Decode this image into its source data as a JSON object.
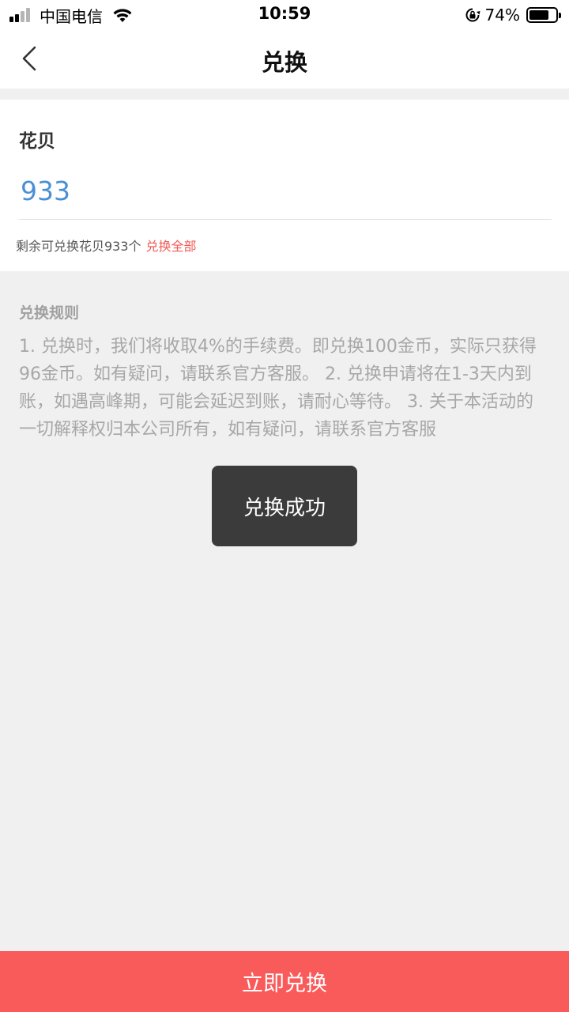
{
  "status_bar": {
    "carrier": "中国电信",
    "time": "10:59",
    "battery_percent": "74%",
    "battery_level": 0.74,
    "signal_bars": 2,
    "icons": [
      "signal-icon",
      "wifi-icon",
      "orientation-lock-icon",
      "battery-icon"
    ]
  },
  "nav": {
    "title": "兑换",
    "back_icon": "chevron-left-icon"
  },
  "form": {
    "label": "花贝",
    "input_value": "933",
    "remaining_text": "剩余可兑换花贝933个",
    "exchange_all_label": "兑换全部"
  },
  "rules": {
    "title": "兑换规则",
    "text": "1. 兑换时，我们将收取4%的手续费。即兑换100金币，实际只获得96金币。如有疑问，请联系官方客服。 2. 兑换申请将在1-3天内到账，如遇高峰期，可能会延迟到账，请耐心等待。 3. 关于本活动的一切解释权归本公司所有，如有疑问，请联系官方客服"
  },
  "toast": {
    "message": "兑换成功"
  },
  "footer": {
    "submit_label": "立即兑换"
  },
  "colors": {
    "accent": "#f95a5a",
    "input_text": "#4a8fd6",
    "link": "#f05a56",
    "background": "#f0f0f0"
  }
}
